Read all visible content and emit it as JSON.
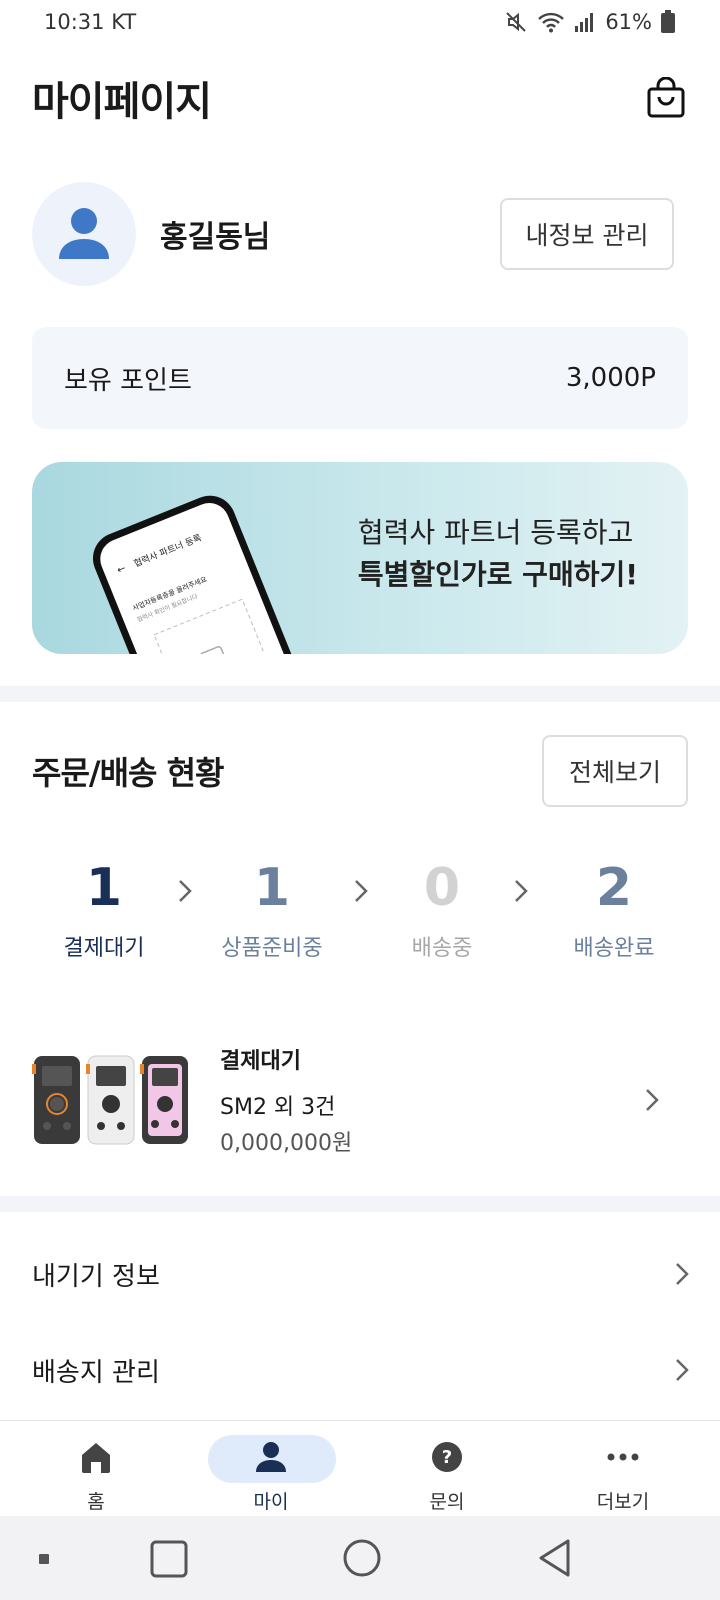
{
  "status_bar": {
    "time_carrier": "10:31 KT",
    "battery": "61%"
  },
  "header": {
    "title": "마이페이지"
  },
  "profile": {
    "name": "홍길동님",
    "manage_button": "내정보 관리"
  },
  "points": {
    "label": "보유 포인트",
    "value": "3,000P"
  },
  "promo": {
    "line1": "협력사 파트너 등록하고",
    "line2": "특별할인가로 구매하기!",
    "phone_title": "협력사 파트너 등록",
    "phone_line1": "사업자등록증을 올려주세요",
    "phone_line2": "협력사 확인이 필요합니다"
  },
  "orders": {
    "title": "주문/배송 현황",
    "view_all": "전체보기",
    "steps": [
      {
        "count": "1",
        "label": "결제대기"
      },
      {
        "count": "1",
        "label": "상품준비중"
      },
      {
        "count": "0",
        "label": "배송중"
      },
      {
        "count": "2",
        "label": "배송완료"
      }
    ],
    "item": {
      "status": "결제대기",
      "name": "SM2 외 3건",
      "price": "0,000,000원"
    }
  },
  "menu": [
    {
      "label": "내기기 정보"
    },
    {
      "label": "배송지 관리"
    }
  ],
  "bottom_nav": [
    {
      "label": "홈",
      "icon": "home-icon"
    },
    {
      "label": "마이",
      "icon": "person-icon"
    },
    {
      "label": "문의",
      "icon": "question-icon"
    },
    {
      "label": "더보기",
      "icon": "more-icon"
    }
  ],
  "colors": {
    "navy": "#1a2f55",
    "slate": "#6b809c",
    "muted": "#c9c9c9",
    "accent_blue": "#3f78c6"
  }
}
